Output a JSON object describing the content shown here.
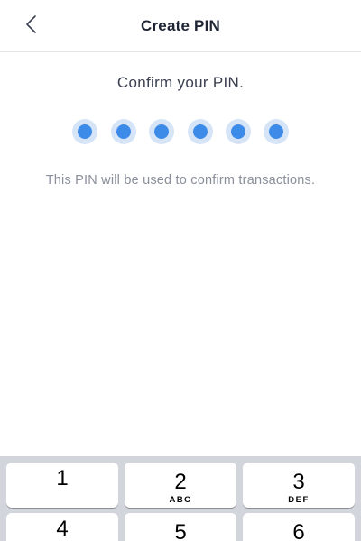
{
  "header": {
    "back_icon": "chevron-left-icon",
    "title": "Create PIN"
  },
  "main": {
    "prompt": "Confirm your PIN.",
    "pin": {
      "length": 6,
      "filled": 6,
      "dot_color": "#3d8be8",
      "halo_color": "#d5e5f7"
    },
    "hint": "This PIN will be used to confirm transactions."
  },
  "keypad": {
    "keys": [
      {
        "number": "1",
        "letters": ""
      },
      {
        "number": "2",
        "letters": "ABC"
      },
      {
        "number": "3",
        "letters": "DEF"
      },
      {
        "number": "4",
        "letters": ""
      },
      {
        "number": "5",
        "letters": ""
      },
      {
        "number": "6",
        "letters": ""
      }
    ]
  }
}
